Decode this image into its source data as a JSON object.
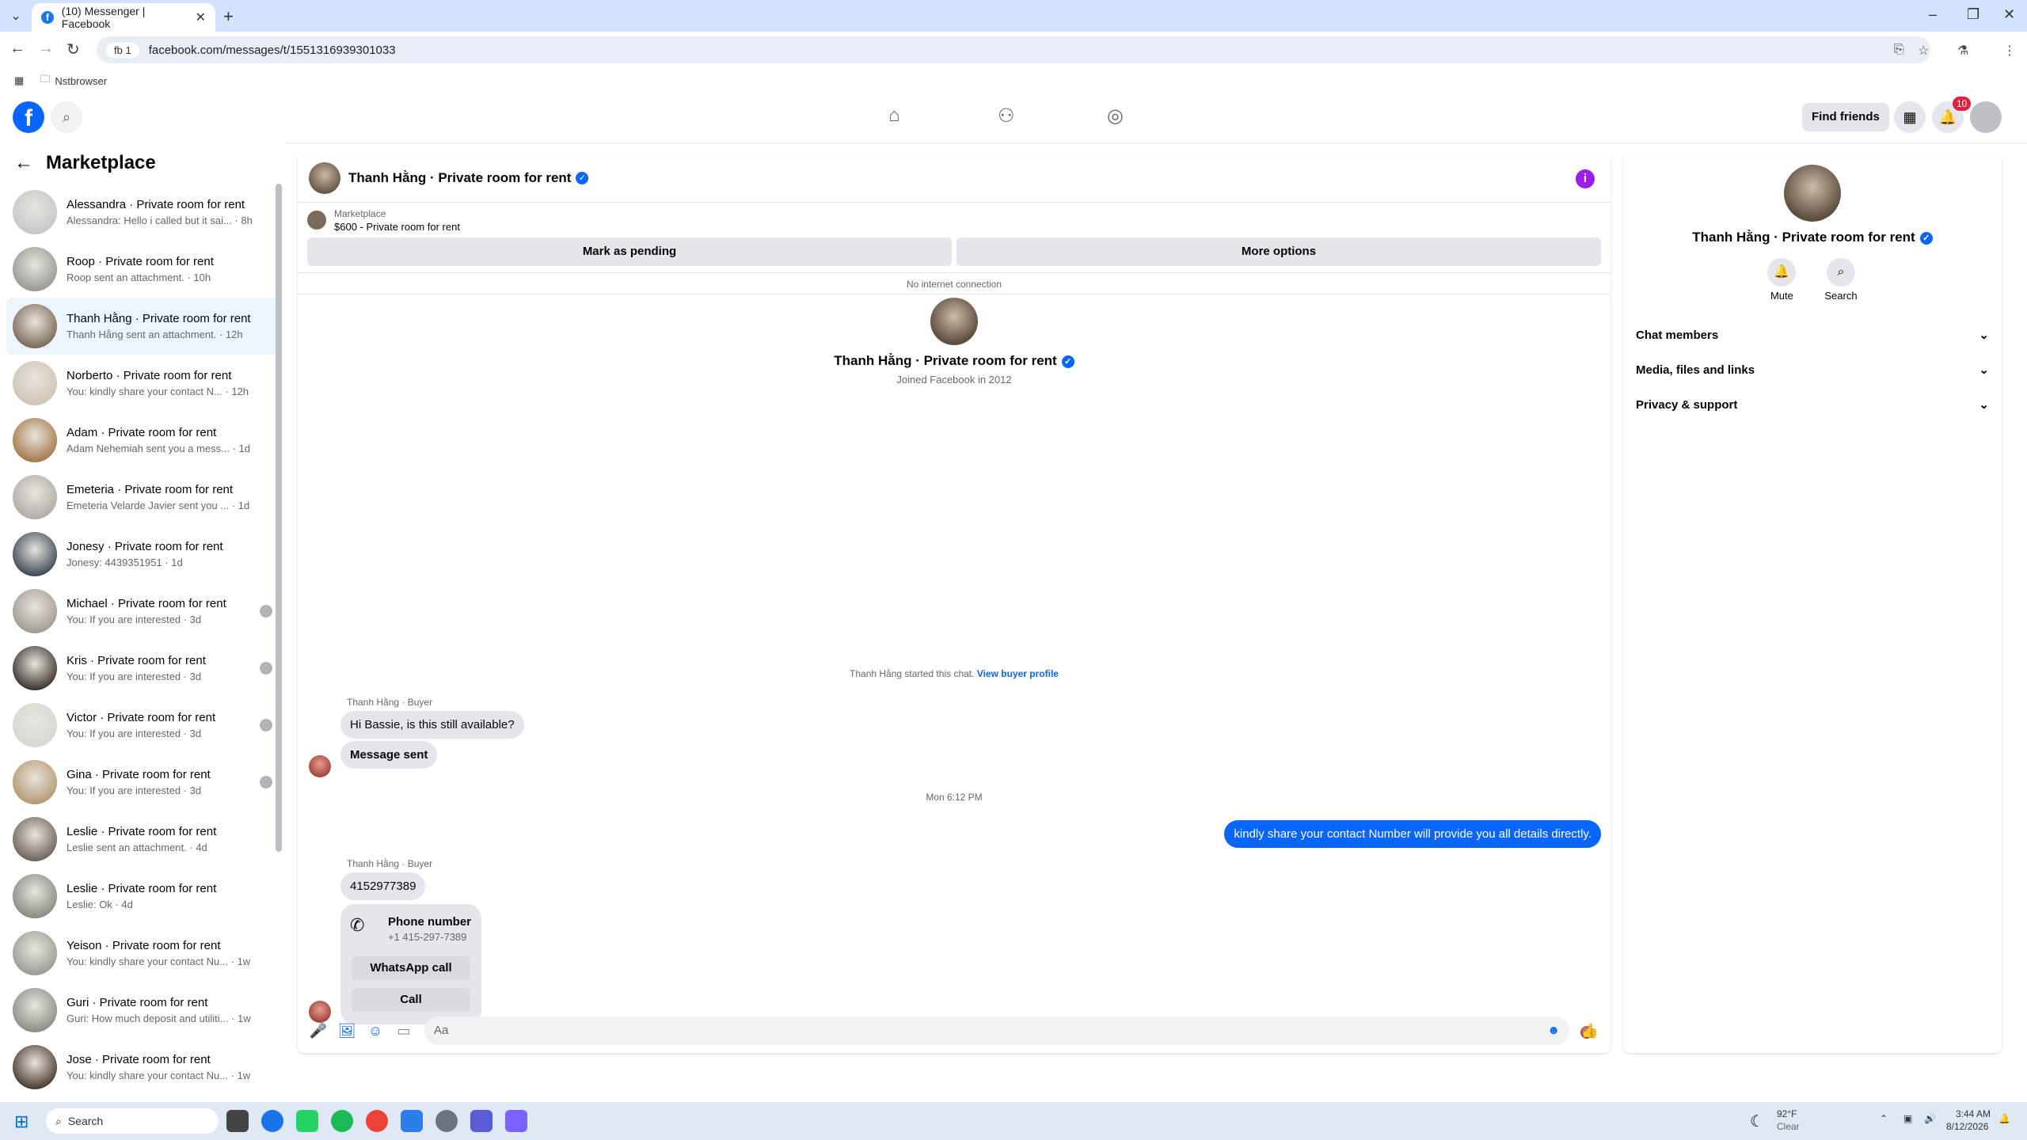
{
  "browser": {
    "tab_title": "(10) Messenger | Facebook",
    "url": "facebook.com/messages/t/1551316939301033",
    "profile_pill": "fb 1",
    "bookmark": "Nstbrowser"
  },
  "fb_header": {
    "find_friends": "Find friends",
    "notif_count": "10"
  },
  "sidebar": {
    "title": "Marketplace",
    "conversations": [
      {
        "title": "Alessandra · Private room for rent",
        "preview": "Alessandra: Hello i called but it sai... · 8h",
        "color": "#c5c8c9"
      },
      {
        "title": "Roop · Private room for rent",
        "preview": "Roop sent an attachment. · 10h",
        "color": "#9a9994"
      },
      {
        "title": "Thanh Hằng · Private room for rent",
        "preview": "Thanh Hằng sent an attachment. · 12h",
        "color": "#7d6b5a"
      },
      {
        "title": "Norberto · Private room for rent",
        "preview": "You: kindly share your contact N... · 12h",
        "color": "#cfc5b6"
      },
      {
        "title": "Adam · Private room for rent",
        "preview": "Adam Nehemiah sent you a mess... · 1d",
        "color": "#a67a4c"
      },
      {
        "title": "Emeteria · Private room for rent",
        "preview": "Emeteria Velarde Javier sent you ... · 1d",
        "color": "#b1aca6"
      },
      {
        "title": "Jonesy · Private room for rent",
        "preview": "Jonesy: 4439351951 · 1d",
        "color": "#3f4a57"
      },
      {
        "title": "Michael · Private room for rent",
        "preview": "You: If you are interested · 3d",
        "color": "#a39c94"
      },
      {
        "title": "Kris · Private room for rent",
        "preview": "You: If you are interested · 3d",
        "color": "#3d3530"
      },
      {
        "title": "Victor · Private room for rent",
        "preview": "You: If you are interested · 3d",
        "color": "#d9d7d3"
      },
      {
        "title": "Gina · Private room for rent",
        "preview": "You: If you are interested · 3d",
        "color": "#b59a73"
      },
      {
        "title": "Leslie · Private room for rent",
        "preview": "Leslie sent an attachment. · 4d",
        "color": "#6f655b"
      },
      {
        "title": "Leslie · Private room for rent",
        "preview": "Leslie: Ok · 4d",
        "color": "#8c8a84"
      },
      {
        "title": "Yeison · Private room for rent",
        "preview": "You: kindly share your contact Nu... · 1w",
        "color": "#9e9b95"
      },
      {
        "title": "Guri · Private room for rent",
        "preview": "Guri: How much deposit and utiliti... · 1w",
        "color": "#8f8d87"
      },
      {
        "title": "Jose · Private room for rent",
        "preview": "You: kindly share your contact Nu... · 1w",
        "color": "#4c3b30"
      }
    ]
  },
  "chat": {
    "title": "Thanh Hằng · Private room for rent",
    "marketplace_label": "Marketplace",
    "listing": "$600 - Private room for rent",
    "mark_pending": "Mark as pending",
    "more_options": "More options",
    "no_internet": "No internet connection",
    "joined": "Joined Facebook in 2012",
    "started_text": "Thanh Hằng started this chat.",
    "view_buyer_profile": "View buyer profile",
    "sender_label": "Thanh Hằng · Buyer",
    "msg1": "Hi Bassie, is this still available?",
    "msg2": "Message sent",
    "timestamp": "Mon 6:12 PM",
    "msg_out": "kindly share your contact Number will provide you all details directly.",
    "msg3": "4152977389",
    "phone_title": "Phone number",
    "phone_number": "+1 415-297-7389",
    "whatsapp_call": "WhatsApp call",
    "call": "Call",
    "composer_placeholder": "Aa"
  },
  "right_panel": {
    "name": "Thanh Hằng · Private room for rent",
    "mute": "Mute",
    "search": "Search",
    "sections": [
      "Chat members",
      "Media, files and links",
      "Privacy & support"
    ]
  },
  "taskbar": {
    "search": "Search",
    "weather_temp": "92°F",
    "weather_desc": "Clear",
    "time": "3:44 AM",
    "date": "8/12/2026"
  }
}
